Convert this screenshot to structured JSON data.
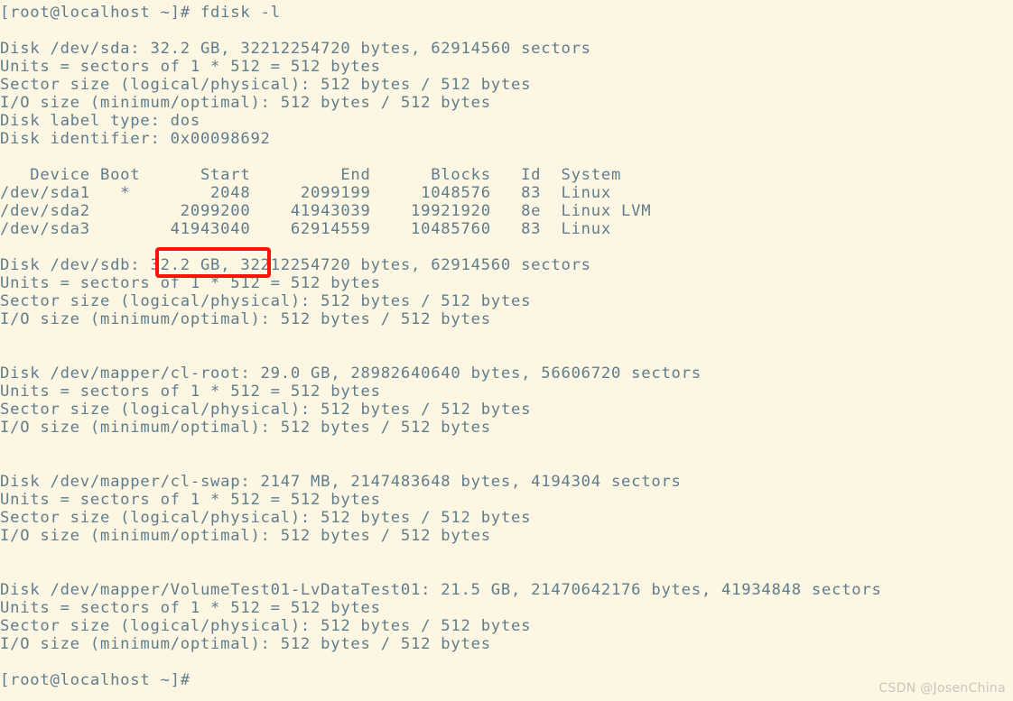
{
  "terminal": {
    "background_color": "#fdf6e3",
    "text_color": "#5f7d8c",
    "prompt": "[root@localhost ~]#",
    "command": "fdisk -l",
    "lines": [
      "[root@localhost ~]# fdisk -l",
      "",
      "Disk /dev/sda: 32.2 GB, 32212254720 bytes, 62914560 sectors",
      "Units = sectors of 1 * 512 = 512 bytes",
      "Sector size (logical/physical): 512 bytes / 512 bytes",
      "I/O size (minimum/optimal): 512 bytes / 512 bytes",
      "Disk label type: dos",
      "Disk identifier: 0x00098692",
      "",
      "   Device Boot      Start         End      Blocks   Id  System",
      "/dev/sda1   *        2048     2099199     1048576   83  Linux",
      "/dev/sda2         2099200    41943039    19921920   8e  Linux LVM",
      "/dev/sda3        41943040    62914559    10485760   83  Linux",
      "",
      "Disk /dev/sdb: 32.2 GB, 32212254720 bytes, 62914560 sectors",
      "Units = sectors of 1 * 512 = 512 bytes",
      "Sector size (logical/physical): 512 bytes / 512 bytes",
      "I/O size (minimum/optimal): 512 bytes / 512 bytes",
      "",
      "",
      "Disk /dev/mapper/cl-root: 29.0 GB, 28982640640 bytes, 56606720 sectors",
      "Units = sectors of 1 * 512 = 512 bytes",
      "Sector size (logical/physical): 512 bytes / 512 bytes",
      "I/O size (minimum/optimal): 512 bytes / 512 bytes",
      "",
      "",
      "Disk /dev/mapper/cl-swap: 2147 MB, 2147483648 bytes, 4194304 sectors",
      "Units = sectors of 1 * 512 = 512 bytes",
      "Sector size (logical/physical): 512 bytes / 512 bytes",
      "I/O size (minimum/optimal): 512 bytes / 512 bytes",
      "",
      "",
      "Disk /dev/mapper/VolumeTest01-LvDataTest01: 21.5 GB, 21470642176 bytes, 41934848 sectors",
      "Units = sectors of 1 * 512 = 512 bytes",
      "Sector size (logical/physical): 512 bytes / 512 bytes",
      "I/O size (minimum/optimal): 512 bytes / 512 bytes",
      "",
      "[root@localhost ~]#"
    ]
  },
  "partition_table": {
    "headers": [
      "Device",
      "Boot",
      "Start",
      "End",
      "Blocks",
      "Id",
      "System"
    ],
    "rows": [
      {
        "device": "/dev/sda1",
        "boot": "*",
        "start": "2048",
        "end": "2099199",
        "blocks": "1048576",
        "id": "83",
        "system": "Linux"
      },
      {
        "device": "/dev/sda2",
        "boot": "",
        "start": "2099200",
        "end": "41943039",
        "blocks": "19921920",
        "id": "8e",
        "system": "Linux LVM"
      },
      {
        "device": "/dev/sda3",
        "boot": "",
        "start": "41943040",
        "end": "62914559",
        "blocks": "10485760",
        "id": "83",
        "system": "Linux"
      }
    ]
  },
  "disks": [
    {
      "name": "/dev/sda",
      "size": "32.2 GB",
      "bytes": "32212254720 bytes",
      "sectors": "62914560 sectors",
      "label_type": "dos",
      "identifier": "0x00098692"
    },
    {
      "name": "/dev/sdb",
      "size": "32.2 GB",
      "bytes": "32212254720 bytes",
      "sectors": "62914560 sectors"
    },
    {
      "name": "/dev/mapper/cl-root",
      "size": "29.0 GB",
      "bytes": "28982640640 bytes",
      "sectors": "56606720 sectors"
    },
    {
      "name": "/dev/mapper/cl-swap",
      "size": "2147 MB",
      "bytes": "2147483648 bytes",
      "sectors": "4194304 sectors"
    },
    {
      "name": "/dev/mapper/VolumeTest01-LvDataTest01",
      "size": "21.5 GB",
      "bytes": "21470642176 bytes",
      "sectors": "41934848 sectors"
    }
  ],
  "annotation": {
    "highlighted_text": "32.2 GB,",
    "target_line": "Disk /dev/sdb: 32.2 GB, 32212254720 bytes, 62914560 sectors",
    "color": "#fc1208"
  },
  "watermark": {
    "text": "CSDN @JosenChina",
    "color": "#c9c6bb"
  }
}
